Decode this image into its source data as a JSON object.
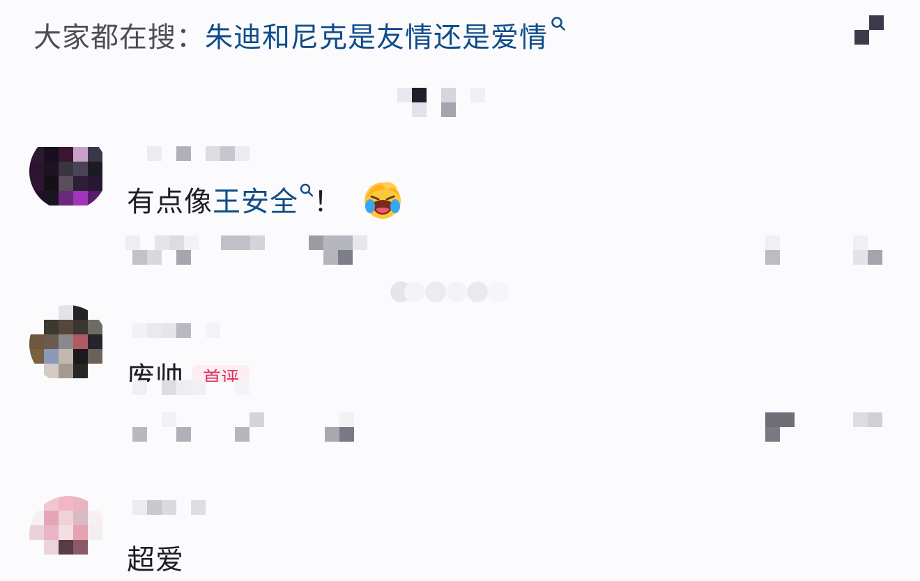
{
  "search": {
    "prefix": "大家都在搜：",
    "term": "朱迪和尼克是友情还是爱情"
  },
  "comments": [
    {
      "parts": [
        "有点像",
        "王安全",
        "！"
      ],
      "mention": "王安全",
      "emoji": "laughing-face-emoji"
    },
    {
      "text": "废帅",
      "badge": "首评"
    },
    {
      "text": "超爱"
    }
  ],
  "colors": {
    "link": "#0f4c8a",
    "text": "#1d1d22",
    "badge_text": "#e0315a",
    "badge_bg": "#fdeef2",
    "background": "#fbfbfd"
  }
}
